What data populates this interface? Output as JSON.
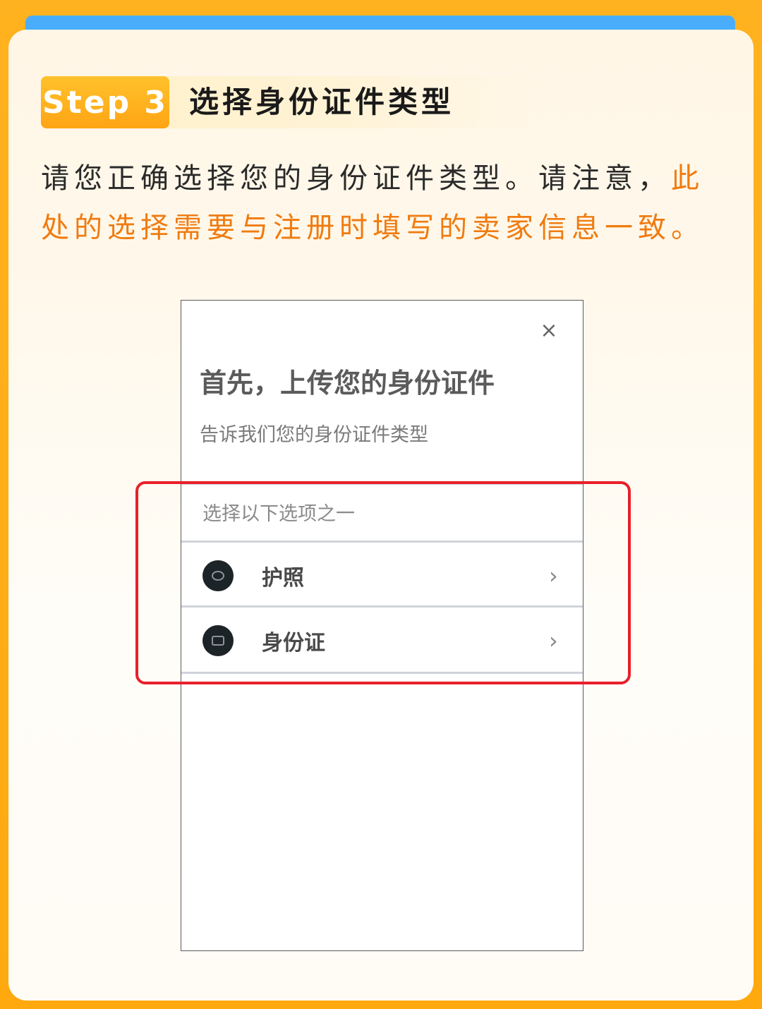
{
  "step": {
    "badge": "Step 3",
    "title": "选择身份证件类型"
  },
  "description": {
    "normal": "请您正确选择您的身份证件类型。请注意，",
    "highlight": "此处的选择需要与注册时填写的卖家信息一致。"
  },
  "modal": {
    "close_symbol": "×",
    "title": "首先，上传您的身份证件",
    "subtitle": "告诉我们您的身份证件类型",
    "select_label": "选择以下选项之一",
    "options": [
      {
        "label": "护照",
        "icon": "passport-icon",
        "chevron": "›"
      },
      {
        "label": "身份证",
        "icon": "id-card-icon",
        "chevron": "›"
      }
    ]
  },
  "colors": {
    "frame": "#ffaa12",
    "accent_blue": "#49adfb",
    "badge": "#ffb01f",
    "highlight": "#f07b10",
    "annotation_box": "#e8202a"
  }
}
